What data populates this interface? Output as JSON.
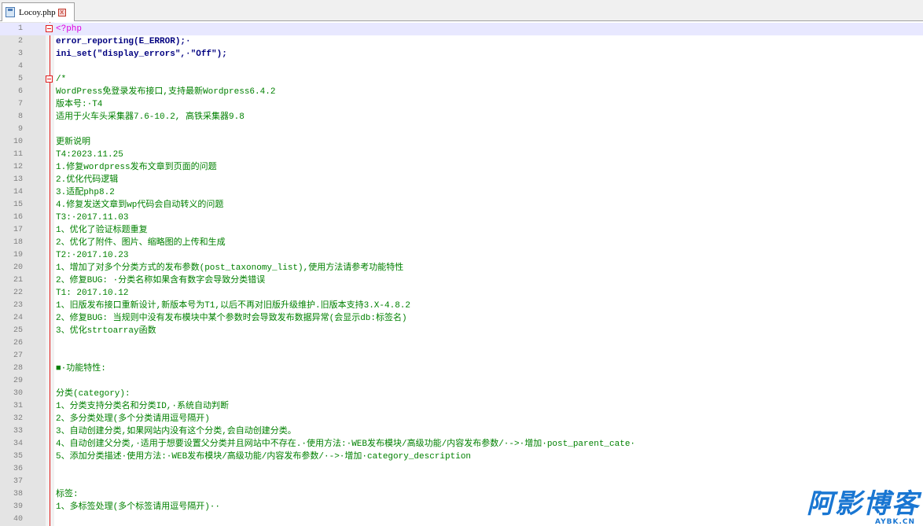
{
  "tab": {
    "label": "Locoy.php",
    "close": "x"
  },
  "editor": {
    "lines": [
      {
        "n": "1",
        "text": "<?php",
        "style": "php"
      },
      {
        "n": "2",
        "text": "error_reporting(E_ERROR);·",
        "style": "mixed"
      },
      {
        "n": "3",
        "text": "ini_set(\"display_errors\",·\"Off\");",
        "style": "mixed"
      },
      {
        "n": "4",
        "text": "",
        "style": "plain"
      },
      {
        "n": "5",
        "text": "/*",
        "style": "comment"
      },
      {
        "n": "6",
        "text": "WordPress免登录发布接口,支持最新Wordpress6.4.2",
        "style": "comment"
      },
      {
        "n": "7",
        "text": "版本号:·T4",
        "style": "comment"
      },
      {
        "n": "8",
        "text": "适用于火车头采集器7.6-10.2, 高铁采集器9.8",
        "style": "comment"
      },
      {
        "n": "9",
        "text": "",
        "style": "comment"
      },
      {
        "n": "10",
        "text": "更新说明",
        "style": "comment"
      },
      {
        "n": "11",
        "text": "T4:2023.11.25",
        "style": "comment"
      },
      {
        "n": "12",
        "text": "1.修复wordpress发布文章到页面的问题",
        "style": "comment"
      },
      {
        "n": "13",
        "text": "2.优化代码逻辑",
        "style": "comment"
      },
      {
        "n": "14",
        "text": "3.适配php8.2",
        "style": "comment"
      },
      {
        "n": "15",
        "text": "4.修复发送文章到wp代码会自动转义的问题",
        "style": "comment"
      },
      {
        "n": "16",
        "text": "T3:·2017.11.03",
        "style": "comment"
      },
      {
        "n": "17",
        "text": "1、优化了验证标题重复",
        "style": "comment"
      },
      {
        "n": "18",
        "text": "2、优化了附件、图片、缩略图的上传和生成",
        "style": "comment"
      },
      {
        "n": "19",
        "text": "T2:·2017.10.23",
        "style": "comment"
      },
      {
        "n": "20",
        "text": "1、增加了对多个分类方式的发布参数(post_taxonomy_list),使用方法请参考功能特性",
        "style": "comment"
      },
      {
        "n": "21",
        "text": "2、修复BUG: ·分类名称如果含有数字会导致分类错误",
        "style": "comment"
      },
      {
        "n": "22",
        "text": "T1: 2017.10.12",
        "style": "comment"
      },
      {
        "n": "23",
        "text": "1、旧版发布接口重新设计,新版本号为T1,以后不再对旧版升级维护.旧版本支持3.X-4.8.2",
        "style": "comment"
      },
      {
        "n": "24",
        "text": "2、修复BUG: 当规则中没有发布模块中某个参数时会导致发布数据异常(会显示db:标签名)",
        "style": "comment"
      },
      {
        "n": "25",
        "text": "3、优化strtoarray函数",
        "style": "comment"
      },
      {
        "n": "26",
        "text": "",
        "style": "comment"
      },
      {
        "n": "27",
        "text": "",
        "style": "comment"
      },
      {
        "n": "28",
        "text": "■·功能特性:",
        "style": "comment"
      },
      {
        "n": "29",
        "text": "",
        "style": "comment"
      },
      {
        "n": "30",
        "text": "分类(category):",
        "style": "comment"
      },
      {
        "n": "31",
        "text": "1、分类支持分类名和分类ID,·系统自动判断",
        "style": "comment"
      },
      {
        "n": "32",
        "text": "2、多分类处理(多个分类请用逗号隔开)",
        "style": "comment"
      },
      {
        "n": "33",
        "text": "3、自动创建分类,如果网站内没有这个分类,会自动创建分类。",
        "style": "comment"
      },
      {
        "n": "34",
        "text": "4、自动创建父分类,·适用于想要设置父分类并且网站中不存在.·使用方法:·WEB发布模块/高级功能/内容发布参数/·->·增加·post_parent_cate·",
        "style": "comment"
      },
      {
        "n": "35",
        "text": "5、添加分类描述·使用方法:·WEB发布模块/高级功能/内容发布参数/·->·增加·category_description",
        "style": "comment"
      },
      {
        "n": "36",
        "text": "",
        "style": "comment"
      },
      {
        "n": "37",
        "text": "",
        "style": "comment"
      },
      {
        "n": "38",
        "text": "标签:",
        "style": "comment"
      },
      {
        "n": "39",
        "text": "1、多标签处理(多个标签请用逗号隔开)··",
        "style": "comment"
      },
      {
        "n": "40",
        "text": "",
        "style": "comment"
      }
    ]
  },
  "watermark": {
    "text": "阿影博客",
    "sub": "AYBK.CN"
  },
  "colors": {
    "comment": "#008000",
    "php_tag": "#e000e0",
    "function": "#000080",
    "gutter": "#e4e4e4",
    "active_line": "#e8e8ff",
    "fold": "#e01b1b",
    "watermark": "#1976d2"
  }
}
